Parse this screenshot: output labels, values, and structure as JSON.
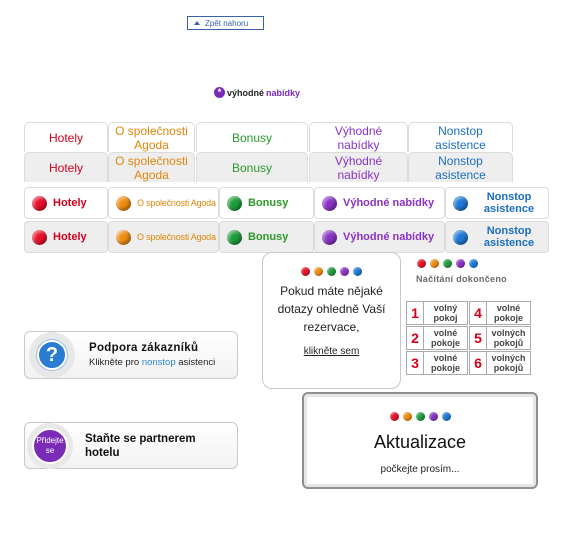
{
  "back_to_top": {
    "label": "Zpět nahoru"
  },
  "deals_logo": {
    "part1": "výhodné",
    "part2": "nabídky",
    "star": "*"
  },
  "tab_row_1": [
    {
      "label": "Hotely",
      "color": "#d6001c"
    },
    {
      "label": "O společnosti Agoda",
      "color": "#e0860a"
    },
    {
      "label": "Bonusy",
      "color": "#2a9a2a"
    },
    {
      "label": "Výhodné nabídky",
      "color": "#8a33c4"
    },
    {
      "label": "Nonstop asistence",
      "color": "#1b6ec2"
    }
  ],
  "tab_row_2": [
    {
      "label": "Hotely"
    },
    {
      "label": "O společnosti Agoda"
    },
    {
      "label": "Bonusy"
    },
    {
      "label": "Výhodné nabídky"
    },
    {
      "label": "Nonstop asistence"
    }
  ],
  "bulb_row_1": [
    {
      "label": "Hotely",
      "bulb": "red"
    },
    {
      "label": "O společnosti Agoda",
      "bulb": "orange"
    },
    {
      "label": "Bonusy",
      "bulb": "green"
    },
    {
      "label": "Výhodné nabídky",
      "bulb": "purple"
    },
    {
      "label": "Nonstop asistence",
      "bulb": "blue"
    }
  ],
  "bulb_row_2": [
    {
      "label": "Hotely",
      "bulb": "red"
    },
    {
      "label": "O společnosti Agoda",
      "bulb": "orange"
    },
    {
      "label": "Bonusy",
      "bulb": "green"
    },
    {
      "label": "Výhodné nabídky",
      "bulb": "purple"
    },
    {
      "label": "Nonstop asistence",
      "bulb": "blue"
    }
  ],
  "question_popup": {
    "message": "Pokud máte nějaké dotazy ohledně Vaší rezervace,",
    "link": "klikněte sem"
  },
  "loading": {
    "label": "Načítání dokončeno"
  },
  "rooms": [
    {
      "num": "1",
      "label": "volný pokoj"
    },
    {
      "num": "4",
      "label": "volné pokoje"
    },
    {
      "num": "2",
      "label": "volné pokoje"
    },
    {
      "num": "5",
      "label": "volných pokojů"
    },
    {
      "num": "3",
      "label": "volné pokoje"
    },
    {
      "num": "6",
      "label": "volných pokojů"
    }
  ],
  "support_box": {
    "title": "Podpora zákazníků",
    "text_before": "Klikněte pro",
    "highlight": "nonstop",
    "text_after": "asistenci",
    "icon": "?"
  },
  "partner_box": {
    "icon_label": "Přidejte se",
    "title": "Staňte se partnerem hotelu"
  },
  "refresh_box": {
    "title": "Aktualizace",
    "subtitle": "počkejte prosím..."
  },
  "colors": {
    "red": "#d6001c",
    "orange": "#e0860a",
    "green": "#2a9a2a",
    "purple": "#8a33c4",
    "blue": "#1b6ec2"
  }
}
